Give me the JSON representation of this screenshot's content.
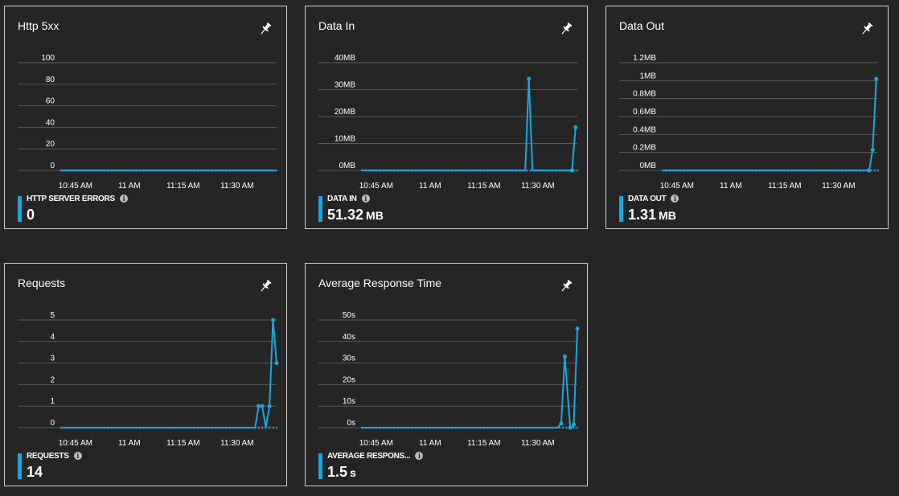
{
  "colors": {
    "background": "#252526",
    "tile_border": "#cfcfcf",
    "series": "#1aa6e0",
    "gridline": "#5a5a5a",
    "axis_text": "#ffffff"
  },
  "icons": {
    "pin": "pin-icon",
    "info": "info-icon"
  },
  "tiles": [
    {
      "title": "Http 5xx",
      "metric_label": "HTTP SERVER ERRORS",
      "metric_value": "0",
      "metric_unit": ""
    },
    {
      "title": "Data In",
      "metric_label": "DATA IN",
      "metric_value": "51.32",
      "metric_unit": "MB"
    },
    {
      "title": "Data Out",
      "metric_label": "DATA OUT",
      "metric_value": "1.31",
      "metric_unit": "MB"
    },
    {
      "title": "Requests",
      "metric_label": "REQUESTS",
      "metric_value": "14",
      "metric_unit": ""
    },
    {
      "title": "Average Response Time",
      "metric_label": "AVERAGE RESPONS...",
      "metric_value": "1.5",
      "metric_unit": "s"
    }
  ],
  "chart_data": [
    {
      "type": "line",
      "x_tick_labels": [
        "10:45 AM",
        "11 AM",
        "11:15 AM",
        "11:30 AM"
      ],
      "x_ticks": [
        45,
        60,
        75,
        90
      ],
      "xlim": [
        41,
        101
      ],
      "y_tick_labels": [
        "100",
        "80",
        "60",
        "40",
        "20",
        "0"
      ],
      "ylim": [
        0,
        100
      ],
      "x": [
        41,
        101
      ],
      "values": [
        0,
        0
      ],
      "markers": [],
      "grid": true
    },
    {
      "type": "line",
      "x_tick_labels": [
        "10:45 AM",
        "11 AM",
        "11:15 AM",
        "11:30 AM"
      ],
      "x_ticks": [
        45,
        60,
        75,
        90
      ],
      "xlim": [
        41,
        101
      ],
      "y_tick_labels": [
        "40MB",
        "30MB",
        "20MB",
        "10MB",
        "0MB"
      ],
      "ylim": [
        0,
        40
      ],
      "x": [
        41,
        86.5,
        87.5,
        88.5,
        99.5,
        100.5
      ],
      "values": [
        0,
        0,
        34,
        0,
        0,
        16
      ],
      "markers": [
        [
          87.5,
          34
        ],
        [
          99.5,
          0
        ],
        [
          100.5,
          16
        ]
      ],
      "grid": true
    },
    {
      "type": "line",
      "x_tick_labels": [
        "10:45 AM",
        "11 AM",
        "11:15 AM",
        "11:30 AM"
      ],
      "x_ticks": [
        45,
        60,
        75,
        90
      ],
      "xlim": [
        41,
        101
      ],
      "y_tick_labels": [
        "1.2MB",
        "1MB",
        "0.8MB",
        "0.6MB",
        "0.4MB",
        "0.2MB",
        "0MB"
      ],
      "ylim": [
        0,
        1.2
      ],
      "x": [
        41,
        98.5,
        99.5,
        100.5
      ],
      "values": [
        0,
        0,
        0.23,
        1.02
      ],
      "markers": [
        [
          98.5,
          0
        ],
        [
          99.5,
          0.23
        ],
        [
          100.5,
          1.02
        ]
      ],
      "grid": true
    },
    {
      "type": "line",
      "x_tick_labels": [
        "10:45 AM",
        "11 AM",
        "11:15 AM",
        "11:30 AM"
      ],
      "x_ticks": [
        45,
        60,
        75,
        90
      ],
      "xlim": [
        41,
        101
      ],
      "y_tick_labels": [
        "5",
        "4",
        "3",
        "2",
        "1",
        "0"
      ],
      "ylim": [
        0,
        5
      ],
      "x": [
        41,
        95,
        96,
        97,
        98,
        99,
        100,
        101
      ],
      "values": [
        0,
        0,
        1,
        1,
        0,
        1,
        5,
        3
      ],
      "markers": [
        [
          96,
          1
        ],
        [
          97,
          1
        ],
        [
          99,
          1
        ],
        [
          100,
          5
        ],
        [
          101,
          3
        ]
      ],
      "grid": true
    },
    {
      "type": "line",
      "x_tick_labels": [
        "10:45 AM",
        "11 AM",
        "11:15 AM",
        "11:30 AM"
      ],
      "x_ticks": [
        45,
        60,
        75,
        90
      ],
      "xlim": [
        41,
        101
      ],
      "y_tick_labels": [
        "50s",
        "40s",
        "30s",
        "20s",
        "10s",
        "0s"
      ],
      "ylim": [
        0,
        50
      ],
      "x": [
        41,
        95.5,
        96.5,
        97.5,
        99,
        100,
        101
      ],
      "values": [
        0,
        0,
        2,
        33,
        0,
        1,
        46
      ],
      "markers": [
        [
          96.5,
          2
        ],
        [
          97.5,
          33
        ],
        [
          99,
          0
        ],
        [
          100,
          1.5
        ],
        [
          101,
          46
        ]
      ],
      "grid": true
    }
  ]
}
